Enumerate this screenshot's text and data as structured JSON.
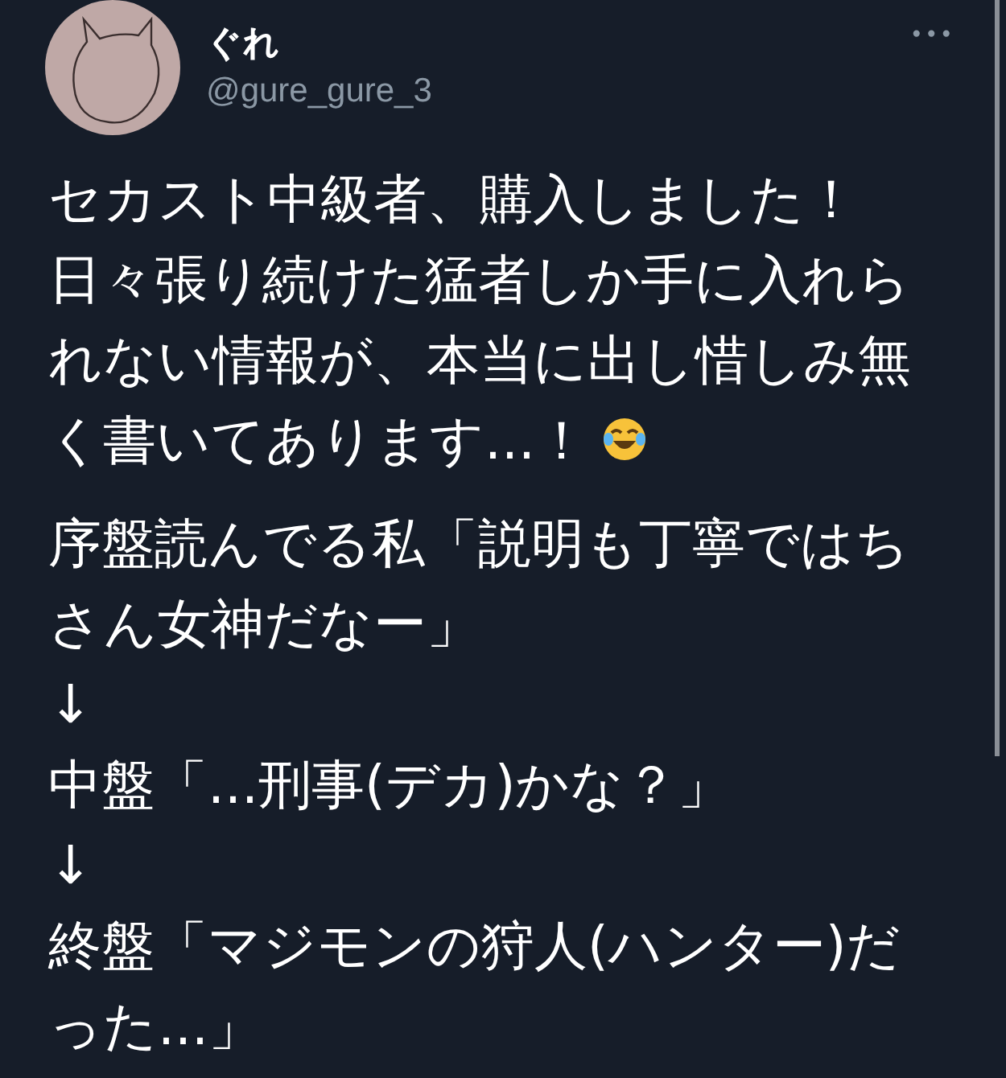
{
  "author": {
    "name": "ぐれ",
    "handle": "@gure_gure_3"
  },
  "more_button": "•••",
  "paragraphs": [
    {
      "lines": [
        {
          "text": "セカスト中級者、購入しました！",
          "kind": "plain"
        },
        {
          "text": "日々張り続けた猛者しか手に入れら",
          "kind": "plain"
        },
        {
          "text": "れない情報が、本当に出し惜しみ無",
          "kind": "plain"
        },
        {
          "text": "く書いてあります...！",
          "kind": "with_emoji"
        }
      ]
    },
    {
      "lines": [
        {
          "text": "序盤読んでる私「説明も丁寧ではち",
          "kind": "plain"
        },
        {
          "text": "さん女神だなー」",
          "kind": "plain"
        },
        {
          "text": "↓",
          "kind": "plain"
        },
        {
          "text": "中盤「...刑事(デカ)かな？」",
          "kind": "plain"
        },
        {
          "text": "↓",
          "kind": "plain"
        },
        {
          "text": "終盤「マジモンの狩人(ハンター)だ",
          "kind": "plain"
        },
        {
          "text": "った...」",
          "kind": "plain"
        }
      ]
    }
  ]
}
